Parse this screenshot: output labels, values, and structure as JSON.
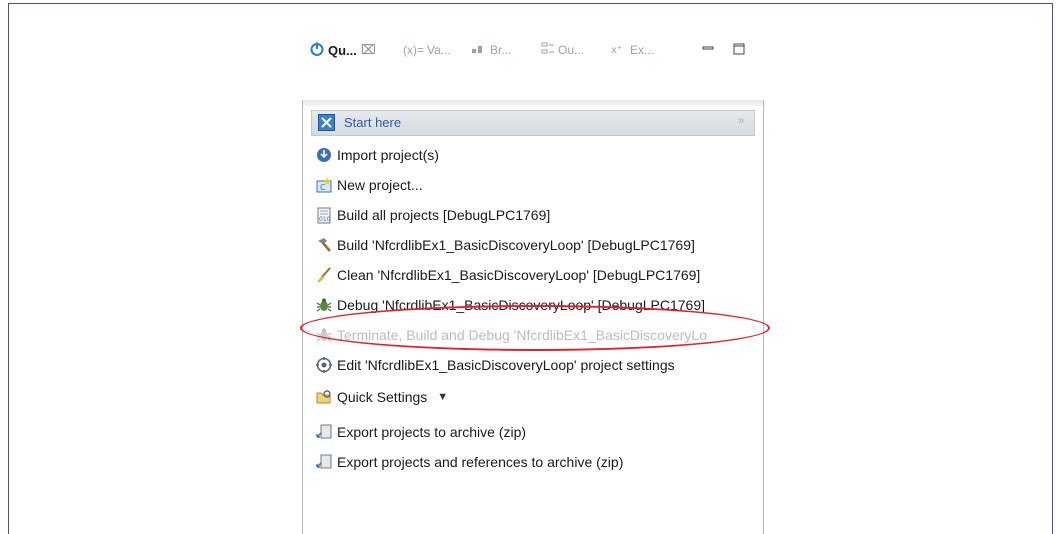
{
  "tabs": [
    {
      "label": "Qu...",
      "icon": "quickstart-icon",
      "active": true
    },
    {
      "label": "Va...",
      "icon": "variables-icon",
      "prefix": "(x)="
    },
    {
      "label": "Br...",
      "icon": "breakpoints-icon"
    },
    {
      "label": "Ou...",
      "icon": "outline-icon"
    },
    {
      "label": "Ex...",
      "icon": "expressions-icon"
    }
  ],
  "tab_close": "⌧",
  "section": {
    "title": "Start here",
    "collapse_glyph": "»"
  },
  "actions": [
    {
      "label": "Import project(s)",
      "icon": "import-icon",
      "enabled": true
    },
    {
      "label": "New project...",
      "icon": "new-project-icon",
      "enabled": true
    },
    {
      "label": "Build all projects [DebugLPC1769]",
      "icon": "build-all-icon",
      "enabled": true
    },
    {
      "label": "Build 'NfcrdlibEx1_BasicDiscoveryLoop' [DebugLPC1769]",
      "icon": "hammer-icon",
      "enabled": true
    },
    {
      "label": "Clean 'NfcrdlibEx1_BasicDiscoveryLoop' [DebugLPC1769]",
      "icon": "broom-icon",
      "enabled": true
    },
    {
      "label": "Debug 'NfcrdlibEx1_BasicDiscoveryLoop' [DebugLPC1769]",
      "icon": "bug-icon",
      "enabled": true,
      "highlighted": true
    },
    {
      "label": "Terminate, Build and Debug 'NfcrdlibEx1_BasicDiscoveryLo",
      "icon": "bug-icon",
      "enabled": false
    },
    {
      "label": "Edit 'NfcrdlibEx1_BasicDiscoveryLoop' project settings",
      "icon": "settings-icon",
      "enabled": true
    },
    {
      "label": "Quick Settings",
      "icon": "quick-settings-icon",
      "enabled": true,
      "dropdown": "▼"
    },
    {
      "label": "Export projects to archive (zip)",
      "icon": "export-icon",
      "enabled": true
    },
    {
      "label": "Export projects and references to archive (zip)",
      "icon": "export-icon",
      "enabled": true
    }
  ],
  "colors": {
    "highlight_oval": "#e0242b",
    "section_title": "#2a5ea8"
  }
}
